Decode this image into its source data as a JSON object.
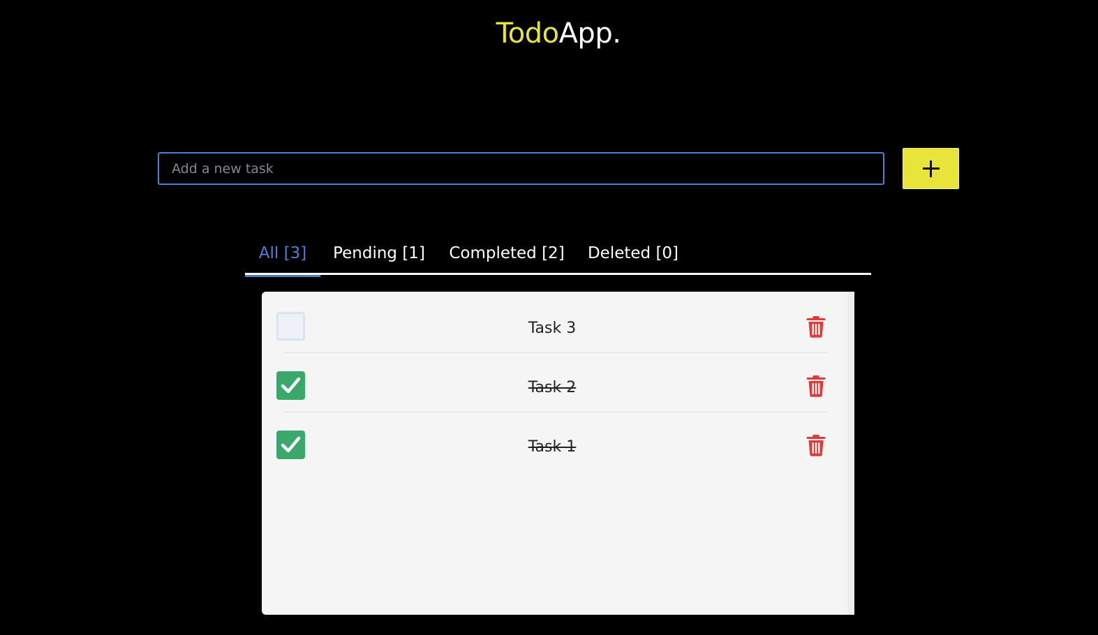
{
  "header": {
    "title_part1": "Todo",
    "title_part2": "App."
  },
  "new_task": {
    "placeholder": "Add a new task",
    "value": "",
    "add_button_icon": "plus-icon"
  },
  "tabs": [
    {
      "label": "All [3]",
      "active": true
    },
    {
      "label": "Pending [1]",
      "active": false
    },
    {
      "label": "Completed [2]",
      "active": false
    },
    {
      "label": "Deleted [0]",
      "active": false
    }
  ],
  "tasks": [
    {
      "label": "Task 3",
      "completed": false,
      "delete_icon": "trash-icon"
    },
    {
      "label": "Task 2",
      "completed": true,
      "delete_icon": "trash-icon"
    },
    {
      "label": "Task 1",
      "completed": true,
      "delete_icon": "trash-icon"
    }
  ],
  "colors": {
    "background": "#000000",
    "accent_yellow": "#e8e43a",
    "accent_blue": "#4a7fd4",
    "check_green": "#3aa86a",
    "delete_red": "#e03a3a"
  }
}
